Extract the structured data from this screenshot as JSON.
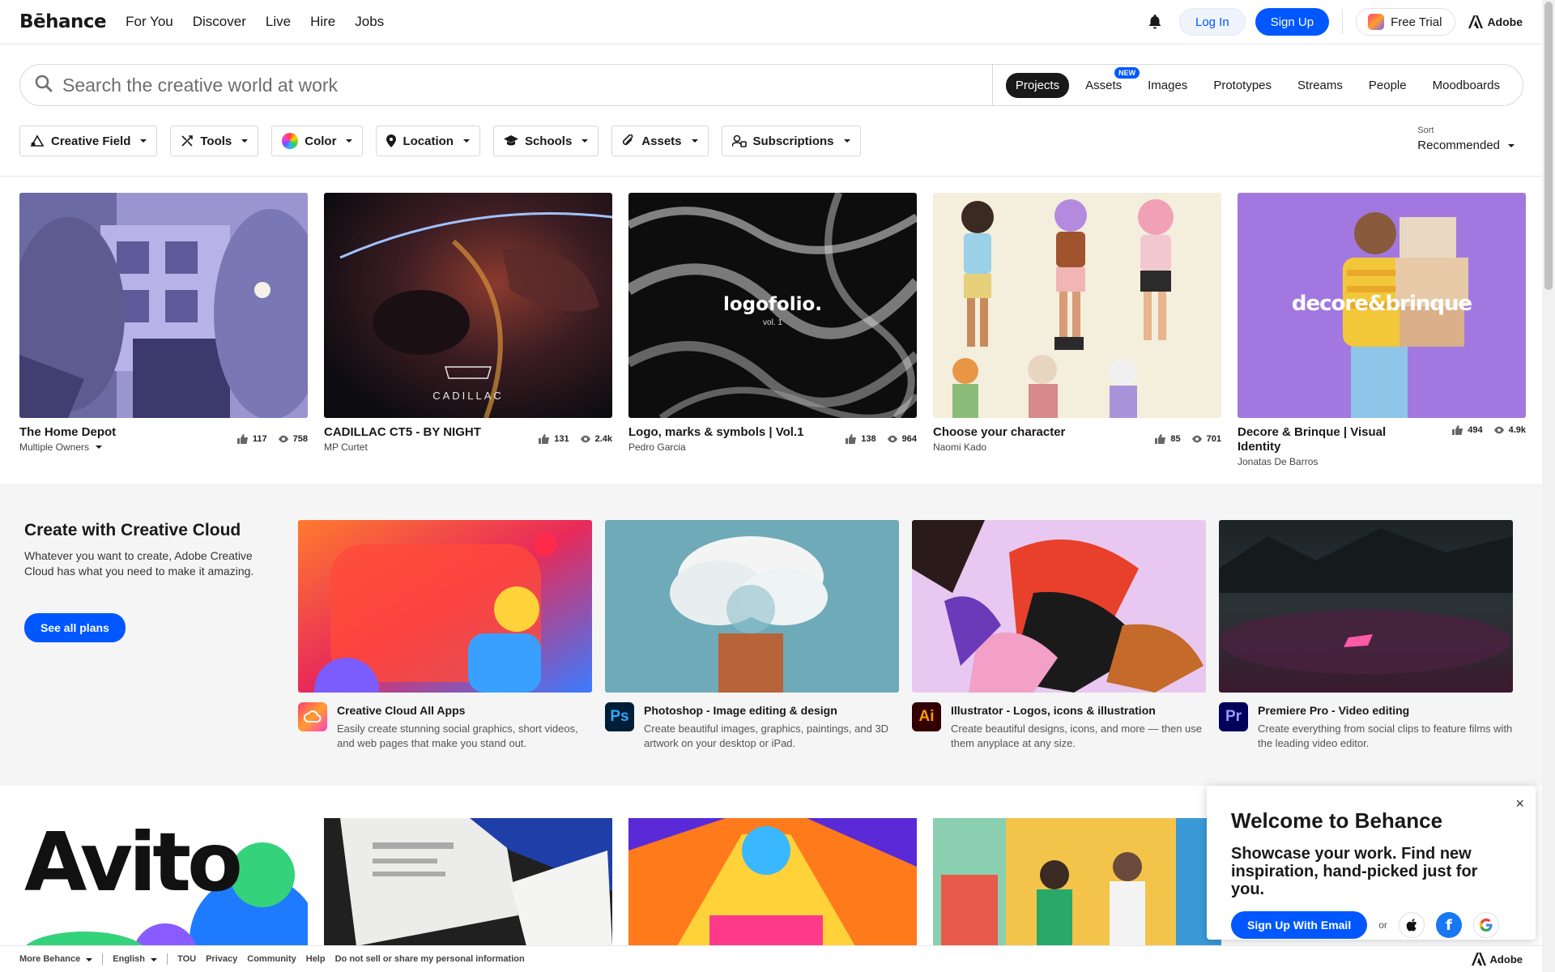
{
  "nav": {
    "logo": "Bēhance",
    "links": [
      "For You",
      "Discover",
      "Live",
      "Hire",
      "Jobs"
    ],
    "login": "Log In",
    "signup": "Sign Up",
    "trial": "Free Trial",
    "adobe": "Adobe"
  },
  "search": {
    "placeholder": "Search the creative world at work",
    "tabs": [
      "Projects",
      "Assets",
      "Images",
      "Prototypes",
      "Streams",
      "People",
      "Moodboards"
    ],
    "new_badge": "NEW"
  },
  "filters": [
    "Creative Field",
    "Tools",
    "Color",
    "Location",
    "Schools",
    "Assets",
    "Subscriptions"
  ],
  "sort": {
    "label": "Sort",
    "value": "Recommended"
  },
  "projects": [
    {
      "title": "The Home Depot",
      "owner": "Multiple Owners",
      "likes": "117",
      "views": "758"
    },
    {
      "title": "CADILLAC CT5 - BY NIGHT",
      "owner": "MP Curtet",
      "likes": "131",
      "views": "2.4k"
    },
    {
      "title": "Logo, marks & symbols | Vol.1",
      "owner": "Pedro Garcia",
      "likes": "138",
      "views": "964"
    },
    {
      "title": "Choose your character",
      "owner": "Naomi Kado",
      "likes": "85",
      "views": "701"
    },
    {
      "title": "Decore & Brinque | Visual Identity",
      "owner": "Jonatas De Barros",
      "likes": "494",
      "views": "4.9k"
    }
  ],
  "thumb_text": {
    "cadillac": "CADILLAC",
    "logofolio": "logofolio.",
    "logofolio_vol": "vol. 1",
    "decore": "decore&brinque",
    "avito": "Avito"
  },
  "cc": {
    "title": "Create with Creative Cloud",
    "desc": "Whatever you want to create, Adobe Creative Cloud has what you need to make it amazing.",
    "button": "See all plans",
    "apps": [
      {
        "icon": "",
        "name": "Creative Cloud All Apps",
        "desc": "Easily create stunning social graphics, short videos, and web pages that make you stand out."
      },
      {
        "icon": "Ps",
        "name": "Photoshop - Image editing & design",
        "desc": "Create beautiful images, graphics, paintings, and 3D artwork on your desktop or iPad."
      },
      {
        "icon": "Ai",
        "name": "Illustrator - Logos, icons & illustration",
        "desc": "Create beautiful designs, icons, and more — then use them anyplace at any size."
      },
      {
        "icon": "Pr",
        "name": "Premiere Pro - Video editing",
        "desc": "Create everything from social clips to feature films with the leading video editor."
      }
    ]
  },
  "welcome": {
    "title": "Welcome to Behance",
    "subtitle": "Showcase your work. Find new inspiration, hand-picked just for you.",
    "button": "Sign Up With Email",
    "or": "or",
    "close": "×"
  },
  "footer": {
    "more": "More Behance",
    "lang": "English",
    "links": [
      "TOU",
      "Privacy",
      "Community",
      "Help",
      "Do not sell or share my personal information"
    ],
    "adobe": "Adobe"
  },
  "colors": {
    "accent": "#0057ff",
    "text": "#191919",
    "band": "#f5f5f5"
  }
}
